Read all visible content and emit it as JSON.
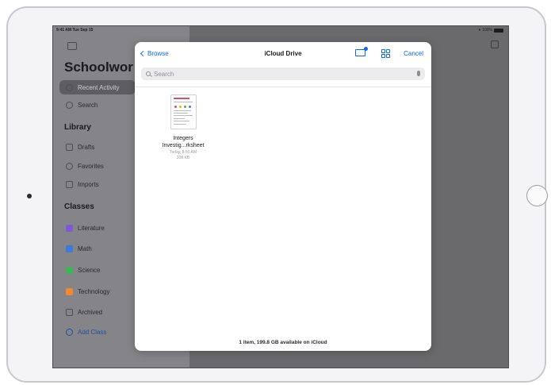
{
  "status_bar": {
    "time": "9:41 AM  Tue Sep 15",
    "battery": "100%"
  },
  "sidebar": {
    "title": "Schoolwor",
    "items": [
      {
        "label": "Recent Activity",
        "icon": "clock-icon"
      },
      {
        "label": "Search",
        "icon": "search-icon"
      }
    ],
    "library_heading": "Library",
    "library": [
      {
        "label": "Drafts",
        "icon": "pencil-icon"
      },
      {
        "label": "Favorites",
        "icon": "heart-icon"
      },
      {
        "label": "Imports",
        "icon": "import-icon"
      }
    ],
    "classes_heading": "Classes",
    "classes": [
      {
        "label": "Literature",
        "color": "#7b5cd6"
      },
      {
        "label": "Math",
        "color": "#3d7bd9"
      },
      {
        "label": "Science",
        "color": "#3fb45a"
      },
      {
        "label": "Technology",
        "color": "#f08a2c"
      }
    ],
    "archived": "Archived",
    "add_class": "Add Class"
  },
  "modal": {
    "back_label": "Browse",
    "title": "iCloud Drive",
    "cancel_label": "Cancel",
    "search_placeholder": "Search",
    "file": {
      "name_line1": "Integers",
      "name_line2": "Investig...rksheet",
      "date": "Today, 8:50 AM",
      "size": "308 KB"
    },
    "footer": "1 item, 199.8 GB available on iCloud"
  },
  "colors": {
    "accent": "#0a66ff"
  }
}
